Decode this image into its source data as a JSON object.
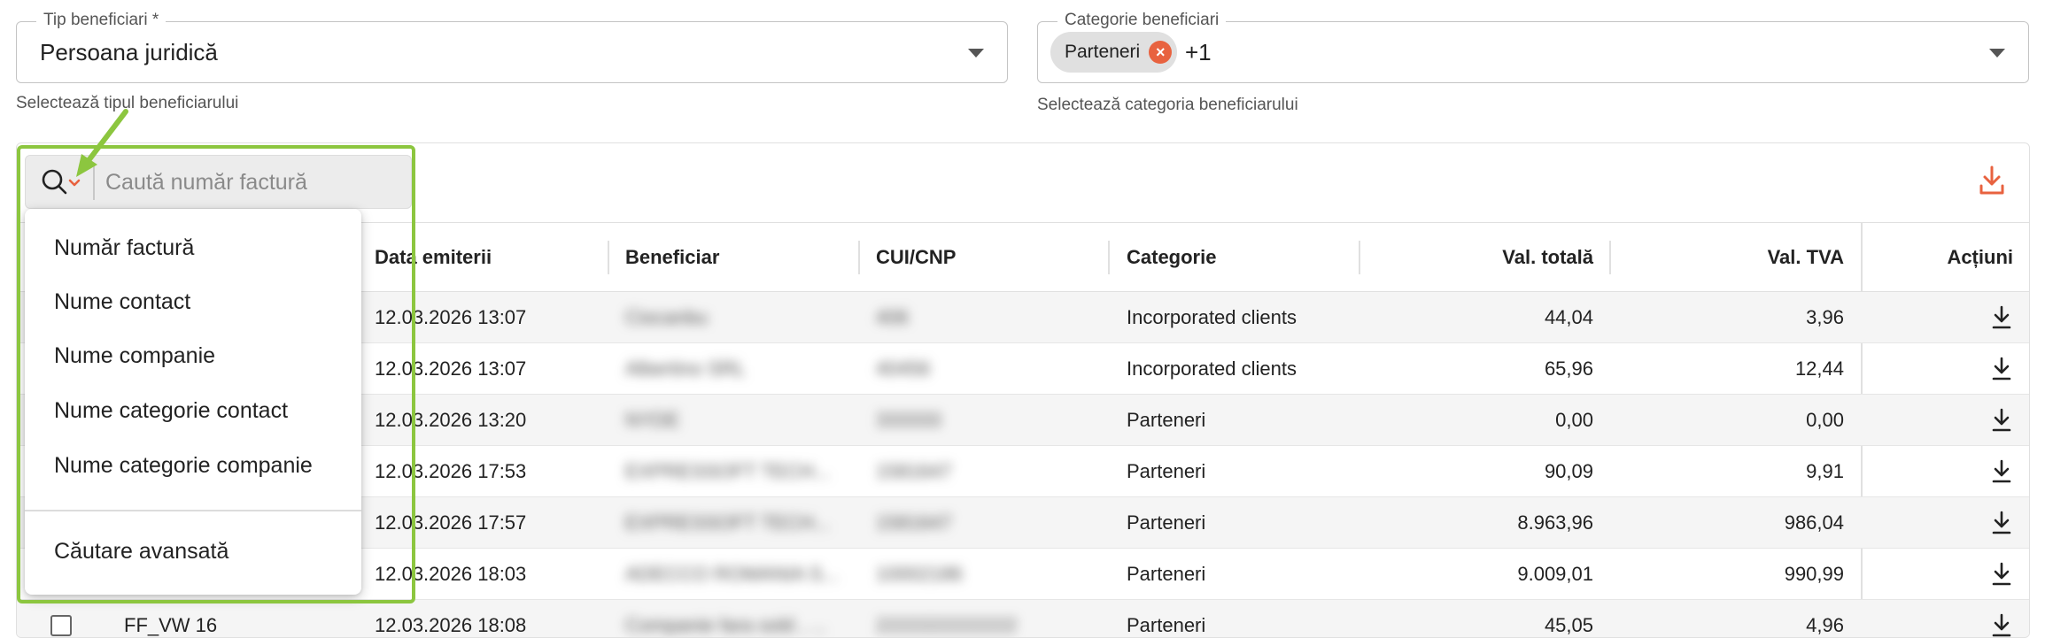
{
  "filters": {
    "tip": {
      "legend": "Tip beneficiari *",
      "value": "Persoana juridică",
      "helper": "Selectează tipul beneficiarului"
    },
    "categorie": {
      "legend": "Categorie beneficiari",
      "chip": "Parteneri",
      "more": "+1",
      "helper": "Selectează categoria beneficiarului"
    }
  },
  "search": {
    "placeholder": "Caută număr factură"
  },
  "menu": {
    "items": [
      "Număr factură",
      "Nume contact",
      "Nume companie",
      "Nume categorie contact",
      "Nume categorie companie"
    ],
    "advanced": "Căutare avansată"
  },
  "table": {
    "columns": {
      "date": "Data emiterii",
      "beneficiar": "Beneficiar",
      "cui": "CUI/CNP",
      "categorie": "Categorie",
      "total": "Val. totală",
      "tva": "Val. TVA",
      "actiuni": "Acțiuni"
    },
    "rows": [
      {
        "number": "",
        "date": "12.03.2026 13:07",
        "beneficiar": "Ciocanbu",
        "cui": "406",
        "categorie": "Incorporated clients",
        "total": "44,04",
        "tva": "3,96"
      },
      {
        "number": "",
        "date": "12.03.2026 13:07",
        "beneficiar": "Albertino SRL",
        "cui": "40456",
        "categorie": "Incorporated clients",
        "total": "65,96",
        "tva": "12,44"
      },
      {
        "number": "",
        "date": "12.03.2026 13:20",
        "beneficiar": "NYDE",
        "cui": "333333",
        "categorie": "Parteneri",
        "total": "0,00",
        "tva": "0,00"
      },
      {
        "number": "",
        "date": "12.03.2026 17:53",
        "beneficiar": "EXPRESSOFT TECH...",
        "cui": "1581647",
        "categorie": "Parteneri",
        "total": "90,09",
        "tva": "9,91"
      },
      {
        "number": "",
        "date": "12.03.2026 17:57",
        "beneficiar": "EXPRESSOFT TECH...",
        "cui": "1581647",
        "categorie": "Parteneri",
        "total": "8.963,96",
        "tva": "986,04"
      },
      {
        "number": "",
        "date": "12.03.2026 18:03",
        "beneficiar": "ADECCO ROMANIA S...",
        "cui": "10002186",
        "categorie": "Parteneri",
        "total": "9.009,01",
        "tva": "990,99"
      },
      {
        "number": "FF_VW 16",
        "date": "12.03.2026 18:08",
        "beneficiar": "Companie fara sold , ...",
        "cui": "2222222222222",
        "categorie": "Parteneri",
        "total": "45,05",
        "tva": "4,96"
      }
    ]
  },
  "colors": {
    "accent": "#e8623f",
    "highlight": "#8cc63f"
  }
}
